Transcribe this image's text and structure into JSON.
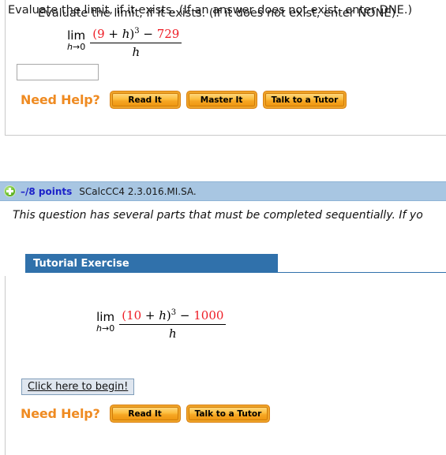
{
  "question_one": {
    "prompt": "Evaluate the limit, if it exists. (If an answer does not exist, enter DNE.)",
    "math": {
      "lim_op": "lim",
      "lim_sub_var": "h",
      "lim_sub_arrow": "→0",
      "num_open_paren": "(",
      "num_base": "9",
      "num_plus_var": " + h",
      "num_close_paren": ")",
      "num_exponent": "3",
      "num_minus": " − ",
      "num_constant": "729",
      "denominator": "h"
    },
    "answer_value": "",
    "answer_placeholder": "",
    "need_help_label": "Need Help?",
    "buttons": [
      {
        "label": "Read It"
      },
      {
        "label": "Master It"
      },
      {
        "label": "Talk to a Tutor"
      }
    ]
  },
  "question_header": {
    "plus_icon": "plus-circle-icon",
    "points": "–/8 points",
    "question_code": "SCalcCC4 2.3.016.MI.SA."
  },
  "question_two": {
    "notice": "This question has several parts that must be completed sequentially. If yo",
    "tutorial_banner": "Tutorial Exercise",
    "prompt": "Evaluate the limit, if it exists. (If it does not exist, enter NONE).",
    "math": {
      "lim_op": "lim",
      "lim_sub_var": "h",
      "lim_sub_arrow": "→0",
      "num_open_paren": "(",
      "num_base": "10",
      "num_plus_var": " + h",
      "num_close_paren": ")",
      "num_exponent": "3",
      "num_minus": " − ",
      "num_constant": "1000",
      "denominator": "h"
    },
    "begin_button": "Click here to begin!",
    "need_help_label": "Need Help?",
    "buttons": [
      {
        "label": "Read It"
      },
      {
        "label": "Talk to a Tutor"
      }
    ]
  },
  "colors": {
    "accent_orange": "#ef8b22",
    "banner_blue": "#3071ab",
    "header_band_blue": "#a8c6e2",
    "points_blue": "#1c22c9",
    "math_red": "#ee1c25"
  }
}
